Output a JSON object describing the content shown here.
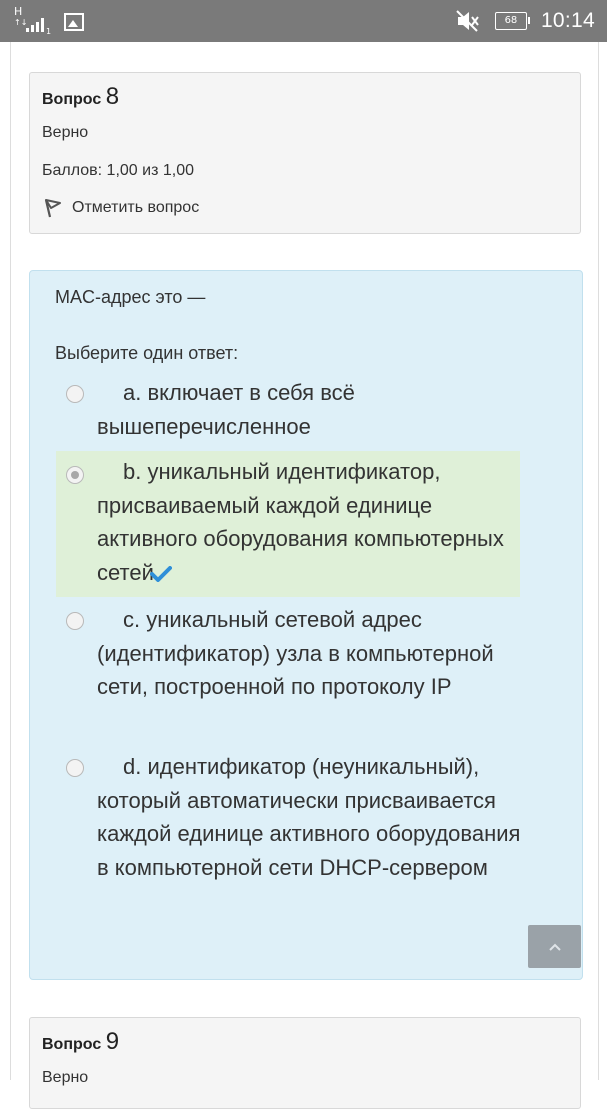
{
  "status_bar": {
    "network_type": "H",
    "network_sub": "↑↓",
    "sim": "1",
    "battery": "68",
    "time": "10:14"
  },
  "question8": {
    "label": "Вопрос",
    "number": "8",
    "state": "Верно",
    "grade": "Баллов: 1,00 из 1,00",
    "flag_label": "Отметить вопрос"
  },
  "question_content": {
    "text": "MAC-адрес это —",
    "prompt": "Выберите один ответ:",
    "answers": [
      {
        "text": "a. включает в себя всё вышеперечисленное",
        "selected": false,
        "correct": false
      },
      {
        "text": "b. уникальный идентификатор, присваиваемый каждой единице активного оборудования компьютерных сетей",
        "selected": true,
        "correct": true
      },
      {
        "text": "c. уникальный сетевой адрес (идентификатор) узла в компьютерной сети, построенной по протоколу IP",
        "selected": false,
        "correct": false
      },
      {
        "text": "d. идентификатор (неуникальный), который автоматически присваивается каждой единице активного оборудования в компьютерной сети DHCP-сервером",
        "selected": false,
        "correct": false
      }
    ]
  },
  "question9": {
    "label": "Вопрос",
    "number": "9",
    "state": "Верно"
  },
  "colors": {
    "content_bg": "#def0f8",
    "correct_bg": "#dff0d8",
    "check": "#2f8fd8",
    "info_bg": "#f5f5f5"
  },
  "icons": [
    "signal-icon",
    "image-icon",
    "mute-icon",
    "battery-icon",
    "flag-icon",
    "check-icon",
    "chevron-up-icon"
  ]
}
